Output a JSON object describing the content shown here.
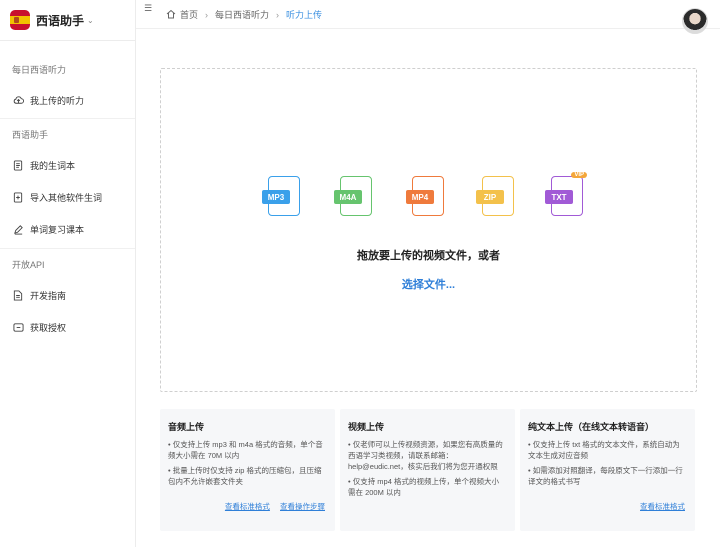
{
  "app": {
    "name": "西语助手"
  },
  "sidebar": {
    "groups": [
      {
        "title": "每日西语听力",
        "items": [
          {
            "label": "我上传的听力",
            "icon": "cloud-upload-icon"
          }
        ]
      },
      {
        "title": "西语助手",
        "items": [
          {
            "label": "我的生词本",
            "icon": "notebook-icon"
          },
          {
            "label": "导入其他软件生词",
            "icon": "import-icon"
          },
          {
            "label": "单词复习课本",
            "icon": "pencil-icon"
          }
        ]
      },
      {
        "title": "开放API",
        "items": [
          {
            "label": "开发指南",
            "icon": "document-icon"
          },
          {
            "label": "获取授权",
            "icon": "key-icon"
          }
        ]
      }
    ]
  },
  "breadcrumb": {
    "home": "首页",
    "section": "每日西语听力",
    "current": "听力上传"
  },
  "upload": {
    "formats": [
      {
        "label": "MP3",
        "color": "#3aa0ea"
      },
      {
        "label": "M4A",
        "color": "#66c46e"
      },
      {
        "label": "MP4",
        "color": "#ef7a3c"
      },
      {
        "label": "ZIP",
        "color": "#f3c14b"
      },
      {
        "label": "TXT",
        "color": "#a15ad6",
        "badge": "VIP"
      }
    ],
    "prompt": "拖放要上传的视频文件，或者",
    "select_label": "选择文件..."
  },
  "cards": [
    {
      "title": "音频上传",
      "lines": [
        "• 仅支持上传 mp3 和 m4a 格式的音频，单个音频大小需在 70M 以内",
        "• 批量上传时仅支持 zip 格式的压缩包，且压缩包内不允许嵌套文件夹"
      ],
      "links": [
        "查看标准格式",
        "查看操作步骤"
      ]
    },
    {
      "title": "视频上传",
      "lines": [
        "• 仅老师可以上传视频资源，如果您有高质量的西语学习类视频，请联系邮箱：help@eudic.net，核实后我们将为您开通权限",
        "• 仅支持 mp4 格式的视频上传，单个视频大小需在 200M 以内"
      ],
      "links": []
    },
    {
      "title": "纯文本上传（在线文本转语音）",
      "lines": [
        "• 仅支持上传 txt 格式的文本文件，系统自动为文本生成对应音频",
        "• 如需添加对照翻译，每段原文下一行添加一行译文的格式书写"
      ],
      "links": [
        "查看标准格式"
      ]
    }
  ]
}
